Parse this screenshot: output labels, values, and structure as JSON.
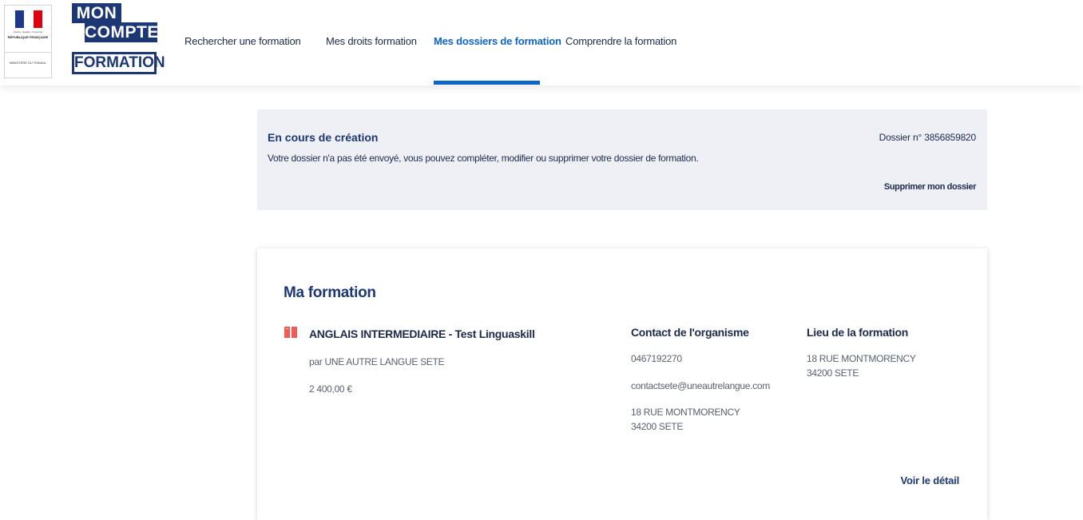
{
  "header": {
    "republic_logo": {
      "line1": "Liberté • Égalité • Fraternité",
      "line2": "RÉPUBLIQUE FRANÇAISE",
      "line3": "MINISTÈRE DU TRAVAIL",
      "flag_colors": [
        "#1d3a8a",
        "#ffffff",
        "#e1000f"
      ]
    },
    "brand": {
      "mon": "MON",
      "compte": "COMPTE",
      "formation": "FORMATION",
      "color": "#1d3775"
    },
    "nav": [
      {
        "label": "Rechercher une formation",
        "active": false
      },
      {
        "label": "Mes droits formation",
        "active": false
      },
      {
        "label": "Mes dossiers de formation",
        "active": true
      },
      {
        "label": "Comprendre la formation",
        "active": false
      }
    ],
    "accent_color": "#0e64c8"
  },
  "status": {
    "title": "En cours de création",
    "description": "Votre dossier n'a pas été envoyé, vous pouvez compléter, modifier ou supprimer votre dossier de formation.",
    "dossier_number": "Dossier n° 3856859820",
    "delete_label": "Supprimer mon dossier"
  },
  "formation": {
    "section_title": "Ma formation",
    "icon": "book-icon",
    "name": "ANGLAIS INTERMEDIAIRE - Test Linguaskill",
    "organism": "par UNE AUTRE LANGUE SETE",
    "price": "2 400,00 €",
    "contact": {
      "heading": "Contact de l'organisme",
      "phone": "0467192270",
      "email": "contactsete@uneautrelangue.com",
      "address_line1": "18 RUE MONTMORENCY",
      "address_line2": "34200 SETE"
    },
    "location": {
      "heading": "Lieu de la formation",
      "address_line1": "18 RUE MONTMORENCY",
      "address_line2": "34200 SETE"
    },
    "detail_link": "Voir le détail",
    "icon_color": "#f25c54"
  }
}
